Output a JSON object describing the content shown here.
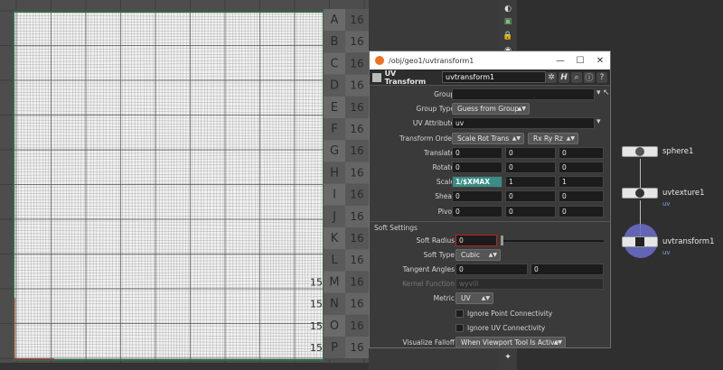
{
  "window": {
    "path": "/obj/geo1/uvtransform1",
    "op_type": "UV Transform",
    "op_name": "uvtransform1"
  },
  "icons": {
    "houdini_logo": "houdini-logo-icon",
    "minimize": "minimize-icon",
    "maximize": "maximize-icon",
    "close": "close-icon",
    "gear": "gear-icon",
    "help_h": "help-h-icon",
    "search": "search-icon",
    "info": "info-icon",
    "question": "question-icon"
  },
  "params": {
    "group": {
      "label": "Group",
      "value": ""
    },
    "group_type": {
      "label": "Group Type",
      "value": "Guess from Group"
    },
    "uv_attribute": {
      "label": "UV Attribute",
      "value": "uv"
    },
    "transform_order": {
      "label": "Transform Order",
      "value": "Scale Rot Trans",
      "value2": "Rx Ry Rz"
    },
    "translate": {
      "label": "Translate",
      "values": [
        "0",
        "0",
        "0"
      ]
    },
    "rotate": {
      "label": "Rotate",
      "values": [
        "0",
        "0",
        "0"
      ]
    },
    "scale": {
      "label": "Scale",
      "values": [
        "1/$XMAX",
        "1",
        "1"
      ]
    },
    "shear": {
      "label": "Shear",
      "values": [
        "0",
        "0",
        "0"
      ]
    },
    "pivot": {
      "label": "Pivot",
      "values": [
        "0",
        "0",
        "0"
      ]
    },
    "soft_section": "Soft Settings",
    "soft_radius": {
      "label": "Soft Radius",
      "value": "0",
      "fraction": 0.0
    },
    "soft_type": {
      "label": "Soft Type",
      "value": "Cubic"
    },
    "tangent_angles": {
      "label": "Tangent Angles",
      "values": [
        "0",
        "0"
      ]
    },
    "kernel_function": {
      "label": "Kernel Function",
      "value": "wyvill"
    },
    "metric": {
      "label": "Metric",
      "value": "UV"
    },
    "ignore_point": {
      "label": "Ignore Point Connectivity",
      "checked": false
    },
    "ignore_uv": {
      "label": "Ignore UV Connectivity",
      "checked": false
    },
    "visualize_falloff": {
      "label": "Visualize Falloff",
      "value": "When Viewport Tool Is Active"
    }
  },
  "uv_grid": {
    "letters": [
      "A",
      "B",
      "C",
      "D",
      "E",
      "F",
      "G",
      "H",
      "I",
      "J",
      "K",
      "L",
      "M",
      "N",
      "O",
      "P"
    ],
    "numbers": [
      "16",
      "16",
      "16",
      "16",
      "16",
      "16",
      "16",
      "16",
      "16",
      "16",
      "16",
      "16",
      "16",
      "16",
      "16",
      "16"
    ],
    "left_numbers": [
      "",
      "",
      "",
      "",
      "",
      "",
      "",
      "",
      "",
      "",
      "",
      "",
      "15",
      "15",
      "15",
      "15"
    ]
  },
  "nodes": [
    {
      "name": "sphere1",
      "type": ""
    },
    {
      "name": "uvtexture1",
      "type": "uv"
    },
    {
      "name": "uvtransform1",
      "type": "uv"
    }
  ],
  "colors": {
    "expr_field": "#3a8c86",
    "soft_radius_border": "#c02020",
    "selected_node": "#7b7bd8",
    "uv_mesh": "#ffffff",
    "uv_border": "#2e6b45"
  }
}
